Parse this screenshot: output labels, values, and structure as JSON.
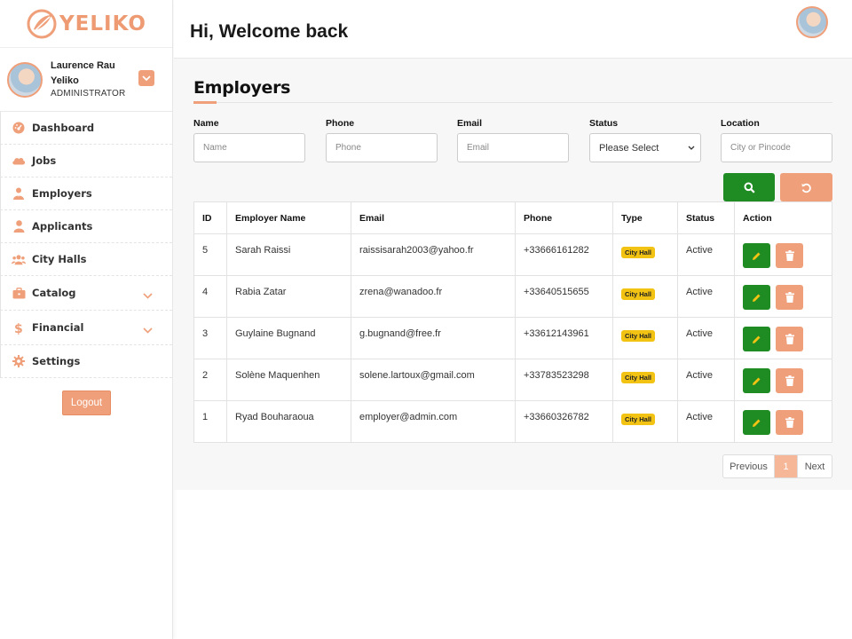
{
  "brand": {
    "name": "YELIKO",
    "color": "#ef9f79"
  },
  "user": {
    "name": "Laurence Rau Yeliko",
    "role": "ADMINISTRATOR"
  },
  "sidebar": {
    "items": [
      {
        "label": "Dashboard",
        "icon": "dashboard-icon"
      },
      {
        "label": "Jobs",
        "icon": "cloud-icon"
      },
      {
        "label": "Employers",
        "icon": "employer-icon"
      },
      {
        "label": "Applicants",
        "icon": "user-icon"
      },
      {
        "label": "City Halls",
        "icon": "users-icon"
      },
      {
        "label": "Catalog",
        "icon": "briefcase-icon"
      },
      {
        "label": "Financial",
        "icon": "dollar-icon"
      },
      {
        "label": "Settings",
        "icon": "gear-icon"
      }
    ],
    "logout_label": "Logout"
  },
  "header": {
    "welcome": "Hi, Welcome back"
  },
  "page": {
    "title": "Employers"
  },
  "filters": {
    "name": {
      "label": "Name",
      "placeholder": "Name"
    },
    "phone": {
      "label": "Phone",
      "placeholder": "Phone"
    },
    "email": {
      "label": "Email",
      "placeholder": "Email"
    },
    "status": {
      "label": "Status",
      "value": "Please Select"
    },
    "location": {
      "label": "Location",
      "placeholder": "City or Pincode"
    }
  },
  "table": {
    "headers": [
      "ID",
      "Employer Name",
      "Email",
      "Phone",
      "Type",
      "Status",
      "Action"
    ],
    "rows": [
      {
        "id": "5",
        "name": "Sarah Raissi",
        "email": "raissisarah2003@yahoo.fr",
        "phone": "+33666161282",
        "type": "City Hall",
        "status": "Active"
      },
      {
        "id": "4",
        "name": "Rabia Zatar",
        "email": "zrena@wanadoo.fr",
        "phone": "+33640515655",
        "type": "City Hall",
        "status": "Active"
      },
      {
        "id": "3",
        "name": "Guylaine Bugnand",
        "email": "g.bugnand@free.fr",
        "phone": "+33612143961",
        "type": "City Hall",
        "status": "Active"
      },
      {
        "id": "2",
        "name": "Solène Maquenhen",
        "email": "solene.lartoux@gmail.com",
        "phone": "+33783523298",
        "type": "City Hall",
        "status": "Active"
      },
      {
        "id": "1",
        "name": "Ryad Bouharaoua",
        "email": "employer@admin.com",
        "phone": "+33660326782",
        "type": "City Hall",
        "status": "Active"
      }
    ]
  },
  "pagination": {
    "prev": "Previous",
    "current": "1",
    "next": "Next"
  }
}
